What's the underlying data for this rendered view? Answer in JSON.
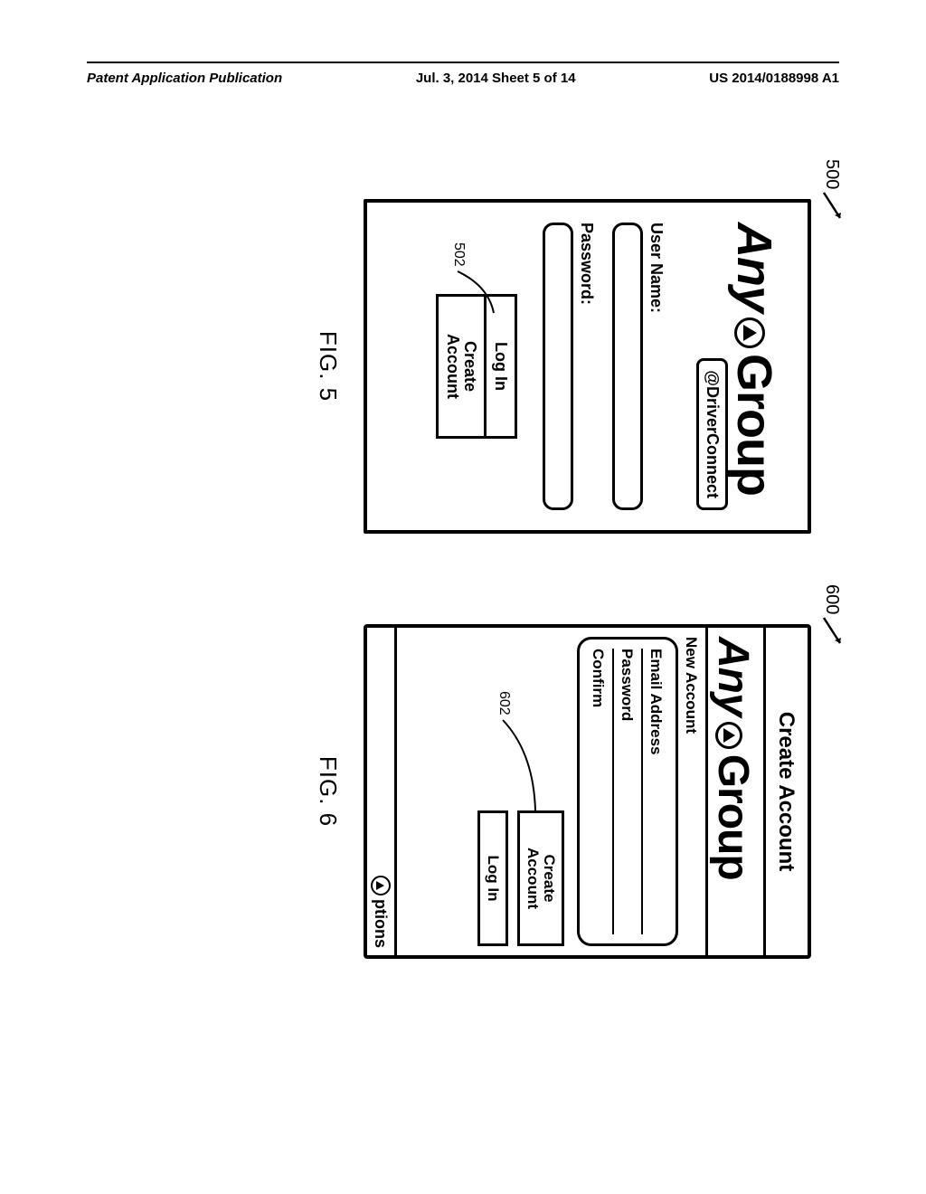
{
  "header": {
    "left": "Patent Application Publication",
    "center": "Jul. 3, 2014   Sheet 5 of 14",
    "right": "US 2014/0188998 A1"
  },
  "fig5": {
    "ref_screen": "500",
    "brand_any": "Any",
    "brand_group": "Group",
    "driverconnect": "@DriverConnect",
    "username_label": "User Name:",
    "password_label": "Password:",
    "login_btn": "Log In",
    "create_btn": "Create\nAccount",
    "ref_btn": "502",
    "caption": "FIG. 5"
  },
  "fig6": {
    "ref_screen": "600",
    "title": "Create Account",
    "brand_any": "Any",
    "brand_group": "Group",
    "section": "New Account",
    "field_email": "Email Address",
    "field_password": "Password",
    "field_confirm": "Confirm",
    "create_btn": "Create\nAccount",
    "login_btn": "Log In",
    "ref_btn": "602",
    "options": "ptions",
    "caption": "FIG. 6"
  }
}
